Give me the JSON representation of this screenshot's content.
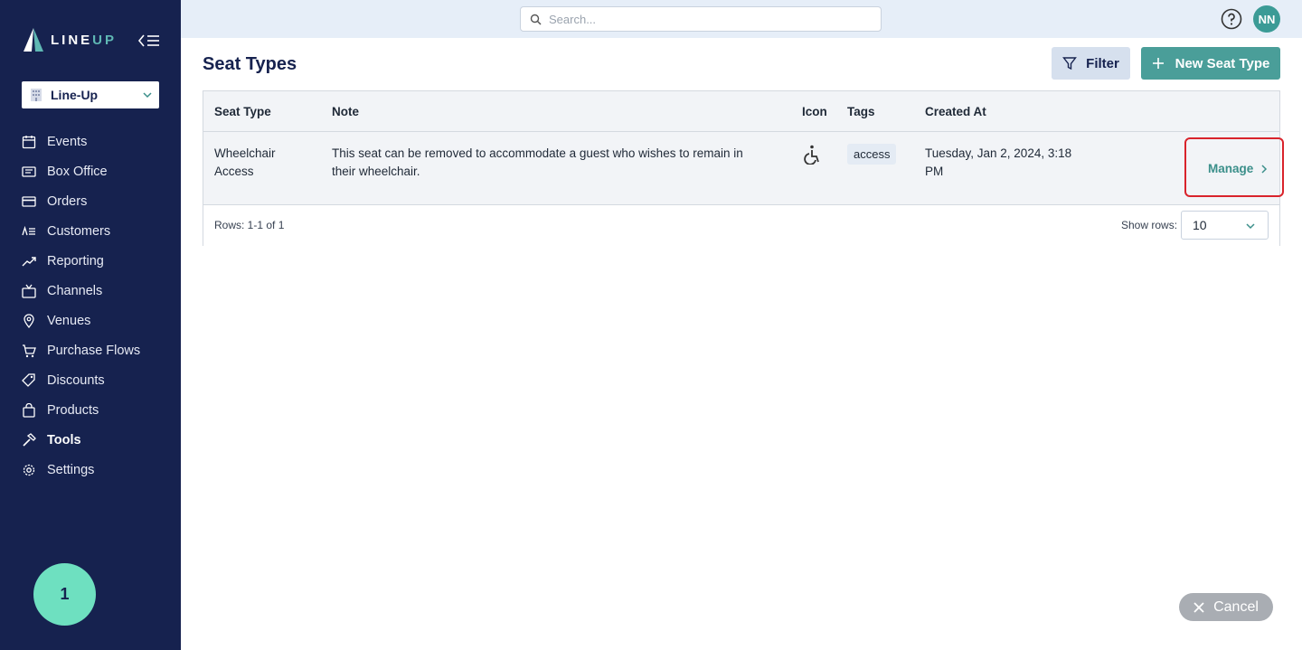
{
  "app": {
    "brand_part1": "LINE",
    "brand_part2": "UP",
    "org_name": "Line-Up"
  },
  "sidebar": {
    "items": [
      {
        "label": "Events",
        "icon": "calendar-icon"
      },
      {
        "label": "Box Office",
        "icon": "ticket-icon"
      },
      {
        "label": "Orders",
        "icon": "credit-card-icon"
      },
      {
        "label": "Customers",
        "icon": "customers-list-icon"
      },
      {
        "label": "Reporting",
        "icon": "trend-chart-icon"
      },
      {
        "label": "Channels",
        "icon": "tv-icon"
      },
      {
        "label": "Venues",
        "icon": "map-pin-icon"
      },
      {
        "label": "Purchase Flows",
        "icon": "cart-icon"
      },
      {
        "label": "Discounts",
        "icon": "tags-icon"
      },
      {
        "label": "Products",
        "icon": "shopping-bag-icon"
      },
      {
        "label": "Tools",
        "icon": "hammer-icon",
        "active": true
      },
      {
        "label": "Settings",
        "icon": "gear-icon"
      }
    ],
    "step_badge": "1"
  },
  "topbar": {
    "search_placeholder": "Search...",
    "avatar_initials": "NN"
  },
  "page": {
    "title": "Seat Types",
    "filter_label": "Filter",
    "new_label": "New Seat Type"
  },
  "table": {
    "headers": [
      "Seat Type",
      "Note",
      "Icon",
      "Tags",
      "Created At"
    ],
    "rows": [
      {
        "seat_type": "Wheelchair Access",
        "note": "This seat can be removed to accommodate a guest who wishes to remain in their wheelchair.",
        "icon": "wheelchair-icon",
        "tag": "access",
        "created_at": "Tuesday, Jan 2, 2024, 3:18 PM",
        "action": "Manage"
      }
    ],
    "rows_info": "Rows: 1-1 of 1",
    "show_rows_label": "Show rows:",
    "show_rows_value": "10"
  },
  "overlay": {
    "cancel_label": "Cancel"
  },
  "colors": {
    "sidebar_bg": "#16224f",
    "accent_teal": "#4a9e99",
    "highlight_red": "#d9232b"
  }
}
